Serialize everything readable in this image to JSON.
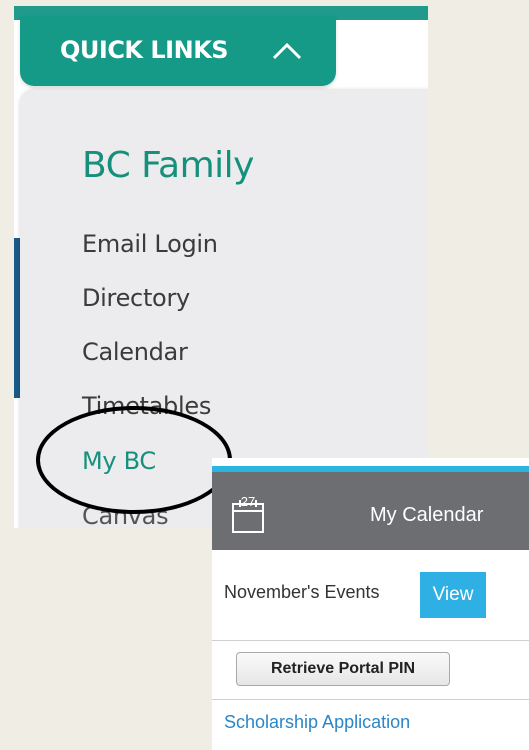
{
  "quick_links": {
    "tab_label": "QUICK LINKS",
    "panel_title": "BC Family",
    "items": [
      {
        "label": "Email Login"
      },
      {
        "label": "Directory"
      },
      {
        "label": "Calendar"
      },
      {
        "label": "Timetables"
      },
      {
        "label": "My BC",
        "active": true
      },
      {
        "label": "Canvas"
      }
    ],
    "colors": {
      "accent": "#149a86",
      "panel_bg": "#ececee",
      "highlight_circle": "#000000"
    }
  },
  "calendar_widget": {
    "icon": "calendar-icon",
    "icon_day": "27",
    "title": "My Calendar",
    "events_label": "November's Events",
    "view_button": "View",
    "pin_button": "Retrieve Portal PIN",
    "link": "Scholarship Application",
    "colors": {
      "header_bg": "#6d6e72",
      "header_accent": "#2bb4e0",
      "view_bg": "#2eb0e4",
      "link": "#2a86c8"
    }
  }
}
